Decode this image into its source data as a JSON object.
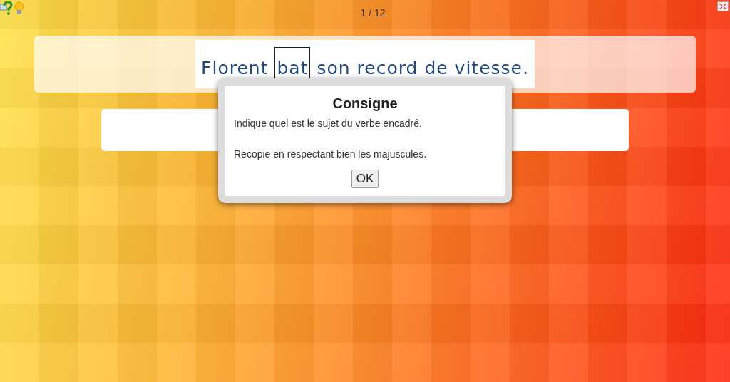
{
  "counter": "1 / 12",
  "sentence": {
    "before": "Florent",
    "framed": "bat",
    "after": "son record de vitesse."
  },
  "dialog": {
    "title": "Consigne",
    "lines": [
      "Indique quel est le sujet du verbe encadré.",
      "Recopie en respectant bien les majuscules."
    ],
    "button": "OK"
  }
}
